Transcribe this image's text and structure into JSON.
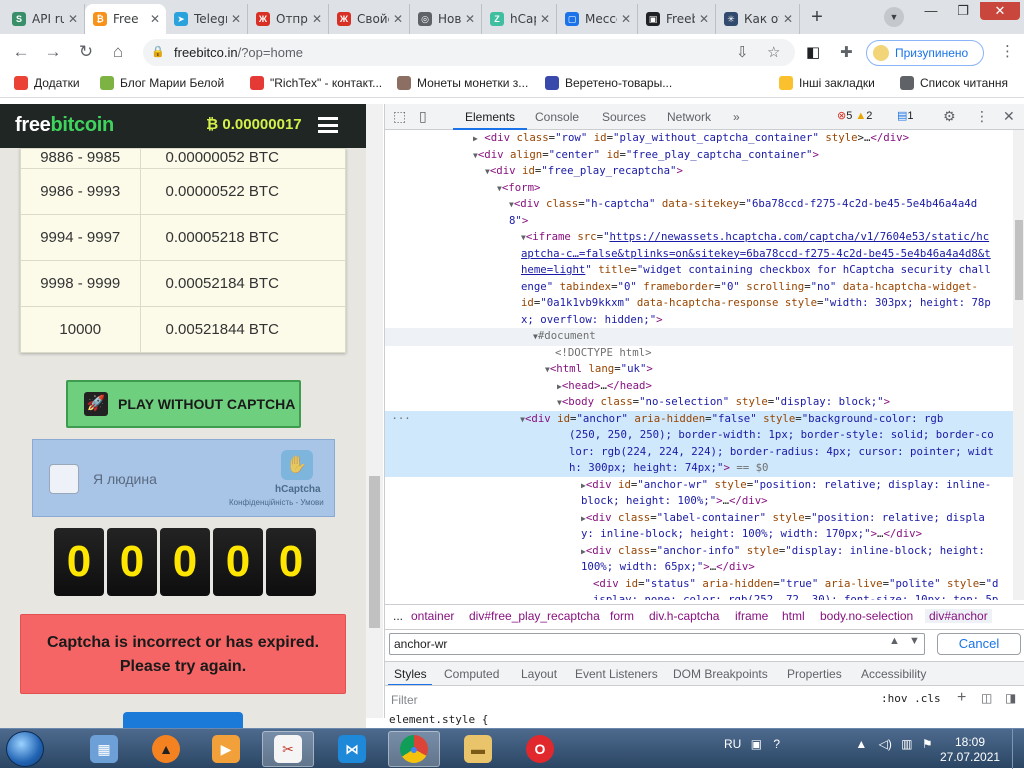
{
  "browser": {
    "tabs": [
      {
        "title": "API ruc",
        "color": "#3a8f6b",
        "glyph": "S"
      },
      {
        "title": "Free",
        "color": "#f7931a",
        "glyph": "₿"
      },
      {
        "title": "Telegra",
        "color": "#2aa3dd",
        "glyph": "➤"
      },
      {
        "title": "Отправ",
        "color": "#d93025",
        "glyph": "Ж"
      },
      {
        "title": "Свойст",
        "color": "#d93025",
        "glyph": "Ж"
      },
      {
        "title": "Нова в",
        "color": "#5f6368",
        "glyph": "◎"
      },
      {
        "title": "hCaptc",
        "color": "#3fbf9f",
        "glyph": "Z"
      },
      {
        "title": "Мессе",
        "color": "#1a73e8",
        "glyph": "▢"
      },
      {
        "title": "Freebit",
        "color": "#202124",
        "glyph": "▣"
      },
      {
        "title": "Как от",
        "color": "#324a6d",
        "glyph": "✳"
      }
    ],
    "new_tab": "+",
    "url_host": "freebitco.in",
    "url_path": "/?op=home",
    "profile_label": "Призупинено",
    "bookmarks": [
      {
        "label": "Додатки",
        "color": "#ea4335"
      },
      {
        "label": "Блог Марии Белой",
        "color": "#7cb342"
      },
      {
        "label": "\"RichTex\" - контакт...",
        "color": "#e53935"
      },
      {
        "label": "Монеты монетки з...",
        "color": "#8d6e63"
      },
      {
        "label": "Веретено-товары...",
        "color": "#3949ab"
      },
      {
        "label": "Інші закладки",
        "color": "#fbc02d"
      },
      {
        "label": "Список читання",
        "color": "#5f6368"
      }
    ]
  },
  "site": {
    "logo_free": "free",
    "logo_bitcoin": "bitcoin",
    "balance": "₿ 0.00000017",
    "rate_rows": [
      {
        "range": "9886 - 9985",
        "payout": "0.00000052 BTC"
      },
      {
        "range": "9986 - 9993",
        "payout": "0.00000522 BTC"
      },
      {
        "range": "9994 - 9997",
        "payout": "0.00005218 BTC"
      },
      {
        "range": "9998 - 9999",
        "payout": "0.00052184 BTC"
      },
      {
        "range": "10000",
        "payout": "0.00521844 BTC"
      }
    ],
    "play_button": "PLAY WITHOUT CAPTCHA",
    "captcha_label": "Я людина",
    "captcha_brand": "hCaptcha",
    "captcha_links": "Конфіденційність - Умови",
    "counter_digits": [
      "0",
      "0",
      "0",
      "0",
      "0"
    ],
    "error_line1": "Captcha is incorrect or has expired.",
    "error_line2": "Please try again."
  },
  "devtools": {
    "tabs": [
      "Elements",
      "Console",
      "Sources",
      "Network"
    ],
    "more": "»",
    "error_count": "5",
    "warning_count": "2",
    "message_count": "1",
    "breadcrumbs": [
      "...",
      "ontainer",
      "div#free_play_recaptcha",
      "form",
      "div.h-captcha",
      "iframe",
      "html",
      "body.no-selection",
      "div#anchor"
    ],
    "search_value": "anchor-wr",
    "cancel_label": "Cancel",
    "style_tabs": [
      "Styles",
      "Computed",
      "Layout",
      "Event Listeners",
      "DOM Breakpoints",
      "Properties",
      "Accessibility"
    ],
    "filter_placeholder": "Filter",
    "hov_cls": ":hov .cls",
    "element_style": "element.style {"
  },
  "taskbar": {
    "lang": "RU",
    "time": "18:09",
    "date": "27.07.2021"
  }
}
